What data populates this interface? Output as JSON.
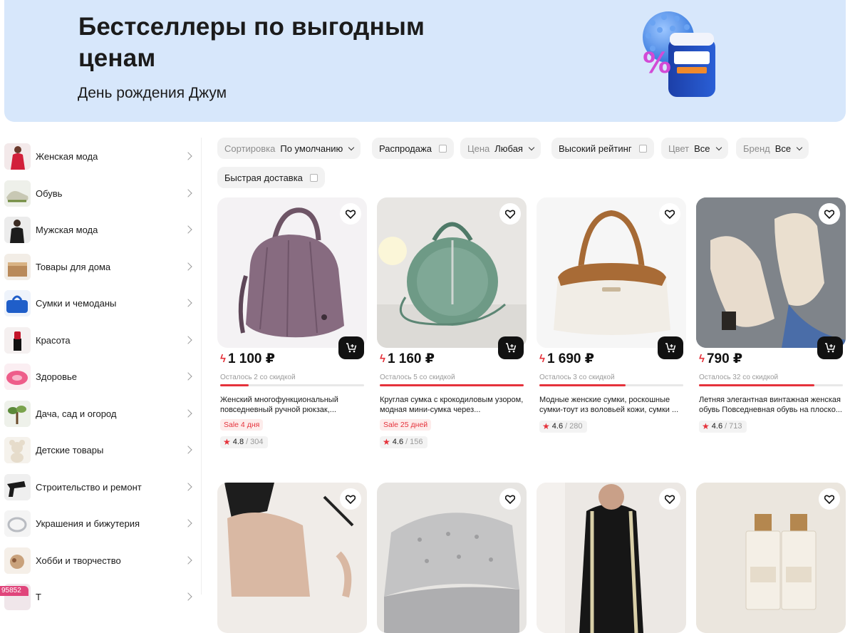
{
  "banner": {
    "title": "Бестселлеры по выгодным ценам",
    "subtitle": "День рождения Джум"
  },
  "categories": [
    {
      "label": "Женская мода",
      "icon": "womens-fashion"
    },
    {
      "label": "Обувь",
      "icon": "shoes"
    },
    {
      "label": "Мужская мода",
      "icon": "mens-fashion"
    },
    {
      "label": "Товары для дома",
      "icon": "home-goods"
    },
    {
      "label": "Сумки и чемоданы",
      "icon": "bags"
    },
    {
      "label": "Красота",
      "icon": "beauty"
    },
    {
      "label": "Здоровье",
      "icon": "health"
    },
    {
      "label": "Дача, сад и огород",
      "icon": "garden"
    },
    {
      "label": "Детские товары",
      "icon": "kids"
    },
    {
      "label": "Строительство и ремонт",
      "icon": "construction"
    },
    {
      "label": "Украшения и бижутерия",
      "icon": "jewelry"
    },
    {
      "label": "Хобби и творчество",
      "icon": "hobby"
    },
    {
      "label": "Т",
      "icon": "more"
    }
  ],
  "counter_badge": "95852",
  "filters": {
    "sort": {
      "label": "Сортировка",
      "value": "По умолчанию"
    },
    "sale": {
      "label": "Распродажа"
    },
    "price": {
      "label": "Цена",
      "value": "Любая"
    },
    "rating": {
      "label": "Высокий рейтинг"
    },
    "color": {
      "label": "Цвет",
      "value": "Все"
    },
    "brand": {
      "label": "Бренд",
      "value": "Все"
    },
    "fast": {
      "label": "Быстрая доставка"
    }
  },
  "products": [
    {
      "price": "1 100 ₽",
      "left": "Осталось 2 со скидкой",
      "progress": 0.2,
      "title": "Женский многофункциональный повседневный ручной рюкзак,...",
      "sale": "Sale 4 дня",
      "rating": "4.8",
      "reviews": "/ 304"
    },
    {
      "price": "1 160 ₽",
      "left": "Осталось 5 со скидкой",
      "progress": 1.0,
      "title": "Круглая сумка с крокодиловым узором, модная мини-сумка через...",
      "sale": "Sale 25 дней",
      "rating": "4.6",
      "reviews": "/ 156"
    },
    {
      "price": "1 690 ₽",
      "left": "Осталось 3 со скидкой",
      "progress": 0.6,
      "title": "Модные женские сумки, роскошные сумки-тоут из воловьей кожи, сумки ...",
      "sale": "",
      "rating": "4.6",
      "reviews": "/ 280"
    },
    {
      "price": "790 ₽",
      "left": "Осталось 32 со скидкой",
      "progress": 0.8,
      "title": "Летняя элегантная винтажная женская обувь Повседневная обувь на плоско...",
      "sale": "",
      "rating": "4.6",
      "reviews": "/ 713"
    }
  ],
  "colors": {
    "accent": "#e5323b",
    "banner": "#d7e7fb",
    "chip": "#f2f2f2"
  }
}
